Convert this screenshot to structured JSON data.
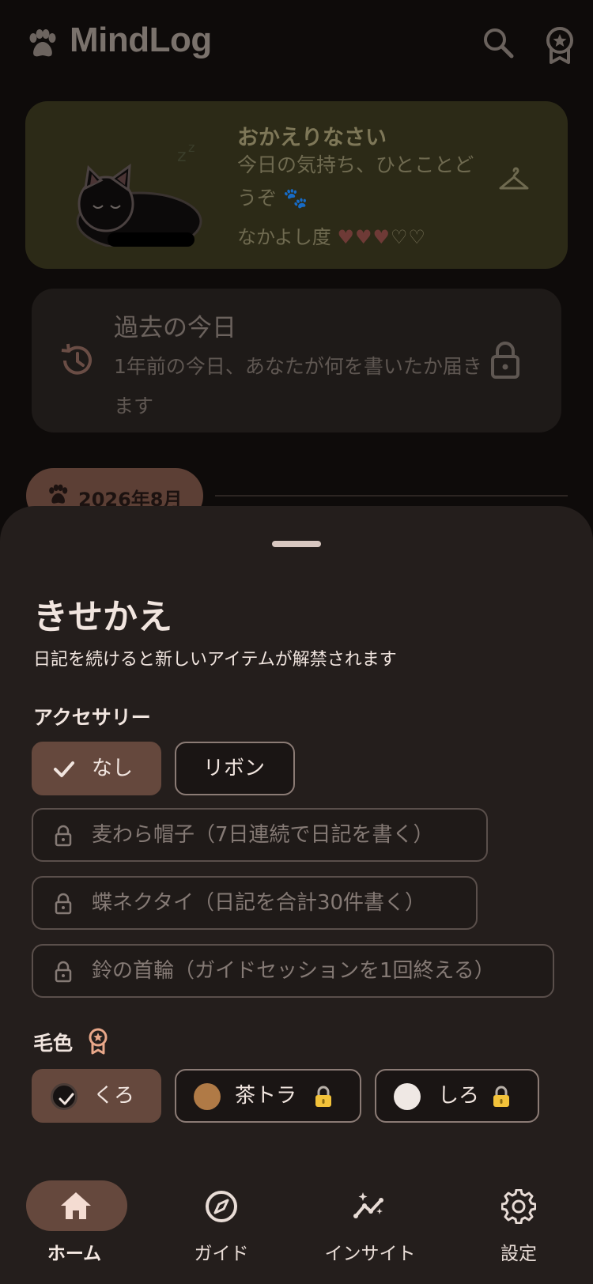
{
  "app": {
    "title": "MindLog"
  },
  "welcome": {
    "title": "おかえりなさい",
    "message": "今日の気持ち、ひとことどうぞ 🐾",
    "affinity_label": "なかよし度",
    "affinity_hearts_full": "♥♥♥",
    "affinity_hearts_empty": "♡♡",
    "affinity_level": 3,
    "affinity_max": 5
  },
  "memory": {
    "title": "過去の今日",
    "description": "1年前の今日、あなたが何を書いたか届きます"
  },
  "timeline": {
    "month": "2026年8月"
  },
  "sheet": {
    "title": "きせかえ",
    "subtitle": "日記を続けると新しいアイテムが解禁されます",
    "accessory_label": "アクセサリー",
    "accessories": [
      {
        "label": "なし",
        "selected": true,
        "locked": false
      },
      {
        "label": "リボン",
        "selected": false,
        "locked": false
      },
      {
        "label": "麦わら帽子（7日連続で日記を書く）",
        "selected": false,
        "locked": true
      },
      {
        "label": "蝶ネクタイ（日記を合計30件書く）",
        "selected": false,
        "locked": true
      },
      {
        "label": "鈴の首輪（ガイドセッションを1回終える）",
        "selected": false,
        "locked": true
      }
    ],
    "fur_label": "毛色",
    "fur_colors": [
      {
        "label": "くろ",
        "color": "#161212",
        "selected": true,
        "locked": false
      },
      {
        "label": "茶トラ",
        "color": "#b07a46",
        "selected": false,
        "locked": true
      },
      {
        "label": "しろ",
        "color": "#efe8e4",
        "selected": false,
        "locked": true
      }
    ]
  },
  "nav": {
    "items": [
      {
        "label": "ホーム",
        "icon": "home-icon",
        "active": true
      },
      {
        "label": "ガイド",
        "icon": "compass-icon",
        "active": false
      },
      {
        "label": "インサイト",
        "icon": "insights-icon",
        "active": false
      },
      {
        "label": "設定",
        "icon": "gear-icon",
        "active": false
      }
    ]
  },
  "colors": {
    "sheet_bg": "#241e1c",
    "selected_chip": "#65483d",
    "welcome_card": "#2c2a17",
    "accent_lock": "#f2c23a"
  }
}
